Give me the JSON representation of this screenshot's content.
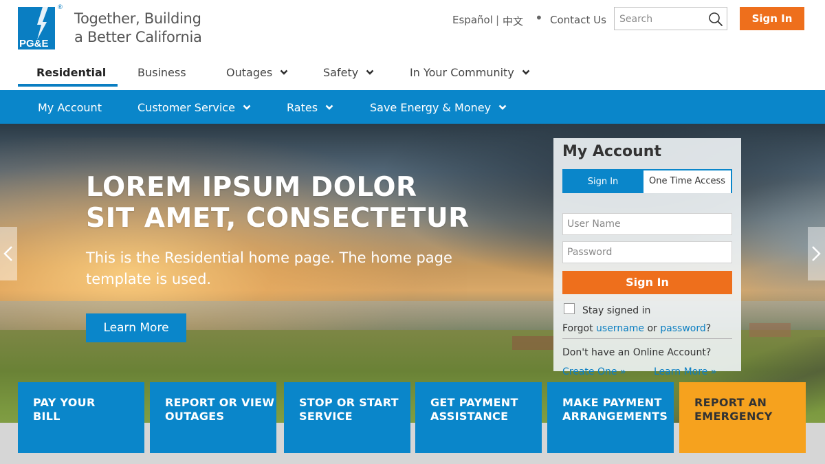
{
  "header": {
    "logo_text": "PG&E",
    "logo_reg": "®",
    "tagline_line1": "Together, Building",
    "tagline_line2": "a Better California",
    "lang_spanish": "Español",
    "lang_separator": "|",
    "lang_chinese": "中文",
    "bullet": "•",
    "contact_us": "Contact Us",
    "search_placeholder": "Search",
    "sign_in": "Sign In"
  },
  "primary_nav": [
    {
      "label": "Residential",
      "active": true,
      "dropdown": false
    },
    {
      "label": "Business",
      "active": false,
      "dropdown": false
    },
    {
      "label": "Outages",
      "active": false,
      "dropdown": true
    },
    {
      "label": "Safety",
      "active": false,
      "dropdown": true
    },
    {
      "label": "In Your Community",
      "active": false,
      "dropdown": true
    }
  ],
  "secondary_nav": [
    {
      "label": "My Account",
      "dropdown": false
    },
    {
      "label": "Customer Service",
      "dropdown": true
    },
    {
      "label": "Rates",
      "dropdown": true
    },
    {
      "label": "Save Energy & Money",
      "dropdown": true
    }
  ],
  "hero": {
    "title_line1": "LOREM IPSUM DOLOR",
    "title_line2": "SIT AMET, CONSECTETUR",
    "subtitle_line1": "This is the Residential home page. The home page",
    "subtitle_line2": "template is used.",
    "cta": "Learn More"
  },
  "account_widget": {
    "title": "My Account",
    "tab_signin": "Sign In",
    "tab_onetime": "One Time Access",
    "username_placeholder": "User Name",
    "password_placeholder": "Password",
    "sign_in": "Sign In",
    "stay_signed_in": "Stay signed in",
    "forgot_prefix": "Forgot",
    "forgot_username": "username",
    "forgot_or": "or",
    "forgot_password": "password",
    "forgot_suffix": "?",
    "no_account": "Don't have an Online Account?",
    "create_one": "Create One »",
    "learn_more": "Learn More »"
  },
  "tiles": [
    {
      "line1": "PAY YOUR",
      "line2": "BILL"
    },
    {
      "line1": "REPORT OR VIEW",
      "line2": "OUTAGES"
    },
    {
      "line1": "STOP OR START",
      "line2": "SERVICE"
    },
    {
      "line1": "GET PAYMENT",
      "line2": "ASSISTANCE"
    },
    {
      "line1": "MAKE PAYMENT",
      "line2": "ARRANGEMENTS"
    },
    {
      "line1": "REPORT AN",
      "line2": "EMERGENCY"
    }
  ],
  "colors": {
    "brand_blue": "#0a86ca",
    "sign_in_orange": "#ee6f1c",
    "emergency_orange": "#f6a21e"
  },
  "icons": {
    "search": "search-icon",
    "chevron": "chevron-down-icon",
    "carousel_prev": "chevron-left-icon",
    "carousel_next": "chevron-right-icon"
  }
}
